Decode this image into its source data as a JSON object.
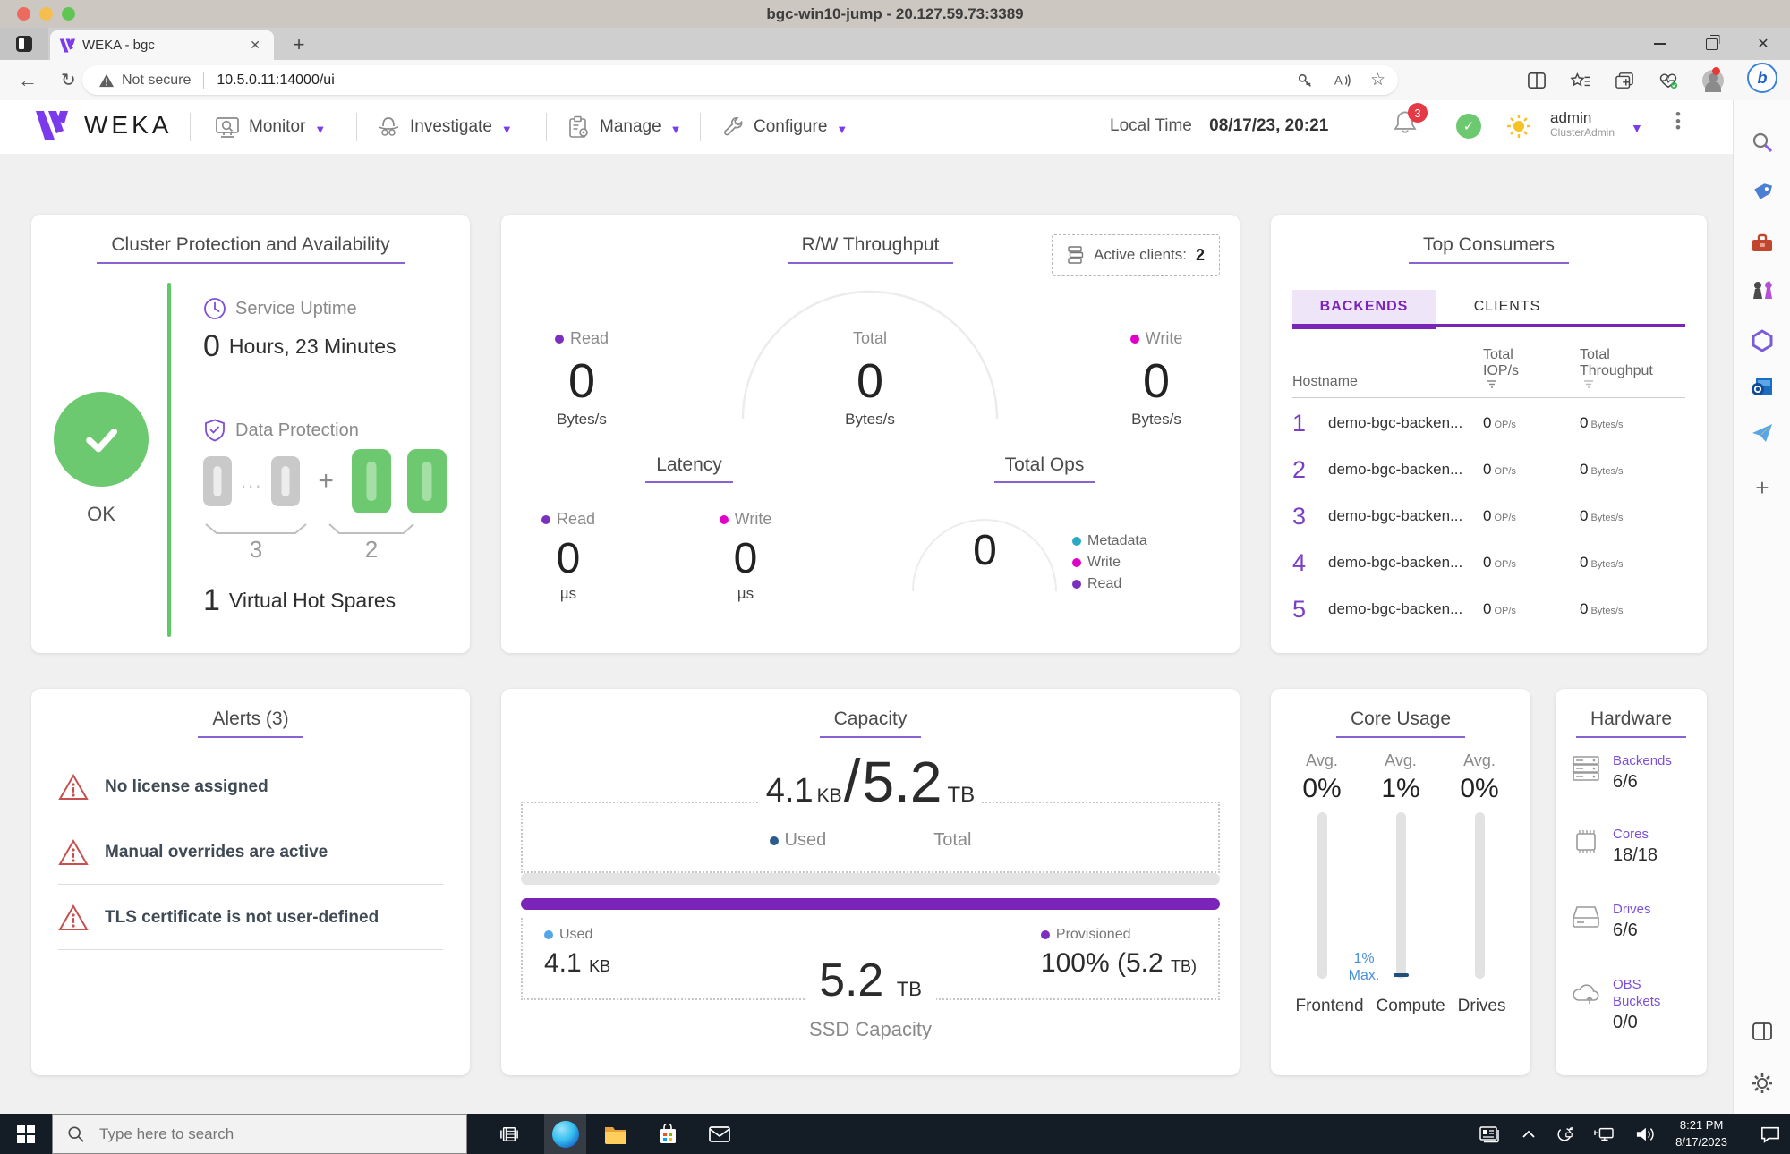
{
  "window": {
    "title": "bgc-win10-jump - 20.127.59.73:3389"
  },
  "browser": {
    "tab_title": "WEKA - bgc",
    "not_secure": "Not secure",
    "url": "10.5.0.11:14000/ui"
  },
  "nav": {
    "brand": "WEKA",
    "menus": [
      {
        "label": "Monitor"
      },
      {
        "label": "Investigate"
      },
      {
        "label": "Manage"
      },
      {
        "label": "Configure"
      }
    ],
    "local_time_label": "Local Time",
    "local_time_value": "08/17/23, 20:21",
    "notifications_badge": "3",
    "user_name": "admin",
    "user_role": "ClusterAdmin"
  },
  "protection": {
    "title": "Cluster Protection and Availability",
    "status_ok": "OK",
    "uptime_label": "Service Uptime",
    "uptime_value": "0",
    "uptime_text": "Hours, 23 Minutes",
    "dp_label": "Data Protection",
    "dp_dots": "...",
    "dp_plus": "+",
    "dp_data_count": "3",
    "dp_parity_count": "2",
    "spares_value": "1",
    "spares_label": "Virtual Hot Spares"
  },
  "throughput": {
    "title": "R/W Throughput",
    "active_clients_label": "Active clients:",
    "active_clients_value": "2",
    "read_label": "Read",
    "read_value": "0",
    "read_unit": "Bytes/s",
    "total_label": "Total",
    "total_value": "0",
    "total_unit": "Bytes/s",
    "write_label": "Write",
    "write_value": "0",
    "write_unit": "Bytes/s"
  },
  "latency": {
    "title": "Latency",
    "read_label": "Read",
    "read_value": "0",
    "read_unit": "µs",
    "write_label": "Write",
    "write_value": "0",
    "write_unit": "µs"
  },
  "total_ops": {
    "title": "Total Ops",
    "value": "0",
    "legend": [
      {
        "label": "Metadata",
        "color": "#2AA8C4"
      },
      {
        "label": "Write",
        "color": "#E100C8"
      },
      {
        "label": "Read",
        "color": "#7B2FBE"
      }
    ]
  },
  "top_consumers": {
    "title": "Top Consumers",
    "tab_backends": "BACKENDS",
    "tab_clients": "CLIENTS",
    "col_hostname": "Hostname",
    "col_total_1": "Total",
    "col_iops": "IOP/s",
    "col_total_2": "Total",
    "col_throughput": "Throughput",
    "rows": [
      {
        "rank": "1",
        "hostname": "demo-bgc-backen...",
        "iops": "0",
        "iops_unit": "OP/s",
        "tp": "0",
        "tp_unit": "Bytes/s"
      },
      {
        "rank": "2",
        "hostname": "demo-bgc-backen...",
        "iops": "0",
        "iops_unit": "OP/s",
        "tp": "0",
        "tp_unit": "Bytes/s"
      },
      {
        "rank": "3",
        "hostname": "demo-bgc-backen...",
        "iops": "0",
        "iops_unit": "OP/s",
        "tp": "0",
        "tp_unit": "Bytes/s"
      },
      {
        "rank": "4",
        "hostname": "demo-bgc-backen...",
        "iops": "0",
        "iops_unit": "OP/s",
        "tp": "0",
        "tp_unit": "Bytes/s"
      },
      {
        "rank": "5",
        "hostname": "demo-bgc-backen...",
        "iops": "0",
        "iops_unit": "OP/s",
        "tp": "0",
        "tp_unit": "Bytes/s"
      }
    ]
  },
  "alerts": {
    "title": "Alerts (3)",
    "items": [
      {
        "text": "No license assigned"
      },
      {
        "text": "Manual overrides are active"
      },
      {
        "text": "TLS certificate is not user-defined"
      }
    ]
  },
  "capacity": {
    "title": "Capacity",
    "used_value": "4.1",
    "used_unit": "KB",
    "slash": "/",
    "total_value": "5.2",
    "total_unit": "TB",
    "used_label": "Used",
    "total_label": "Total",
    "ssd_used_label": "Used",
    "ssd_used_value": "4.1",
    "ssd_used_unit": "KB",
    "ssd_value": "5.2",
    "ssd_unit": "TB",
    "ssd_caption": "SSD Capacity",
    "prov_label": "Provisioned",
    "prov_value": "100% (5.2",
    "prov_unit": "TB)"
  },
  "core_usage": {
    "title": "Core Usage",
    "columns": [
      {
        "avg": "Avg.",
        "value": "0%",
        "name": "Frontend"
      },
      {
        "avg": "Avg.",
        "value": "1%",
        "name": "Compute",
        "max": "1% Max."
      },
      {
        "avg": "Avg.",
        "value": "0%",
        "name": "Drives"
      }
    ]
  },
  "hardware": {
    "title": "Hardware",
    "items": [
      {
        "label": "Backends",
        "value": "6/6"
      },
      {
        "label": "Cores",
        "value": "18/18"
      },
      {
        "label": "Drives",
        "value": "6/6"
      },
      {
        "label": "OBS Buckets",
        "value": "0/0"
      }
    ]
  },
  "taskbar": {
    "search_placeholder": "Type here to search",
    "time": "8:21 PM",
    "date": "8/17/2023"
  },
  "colors": {
    "accent_purple": "#7B24B8",
    "underline_purple": "#8A63D2",
    "ok_green": "#6DC96F",
    "alert_red": "#C94F4F",
    "write_magenta": "#E100C8",
    "metadata_cyan": "#2AA8C4",
    "read_purple": "#7B2FBE",
    "used_blue_dark": "#2A5B8C",
    "used_blue_light": "#53A7E8",
    "provisioned_purple": "#7B2FBE",
    "max_annotation_blue": "#4A90D9"
  }
}
